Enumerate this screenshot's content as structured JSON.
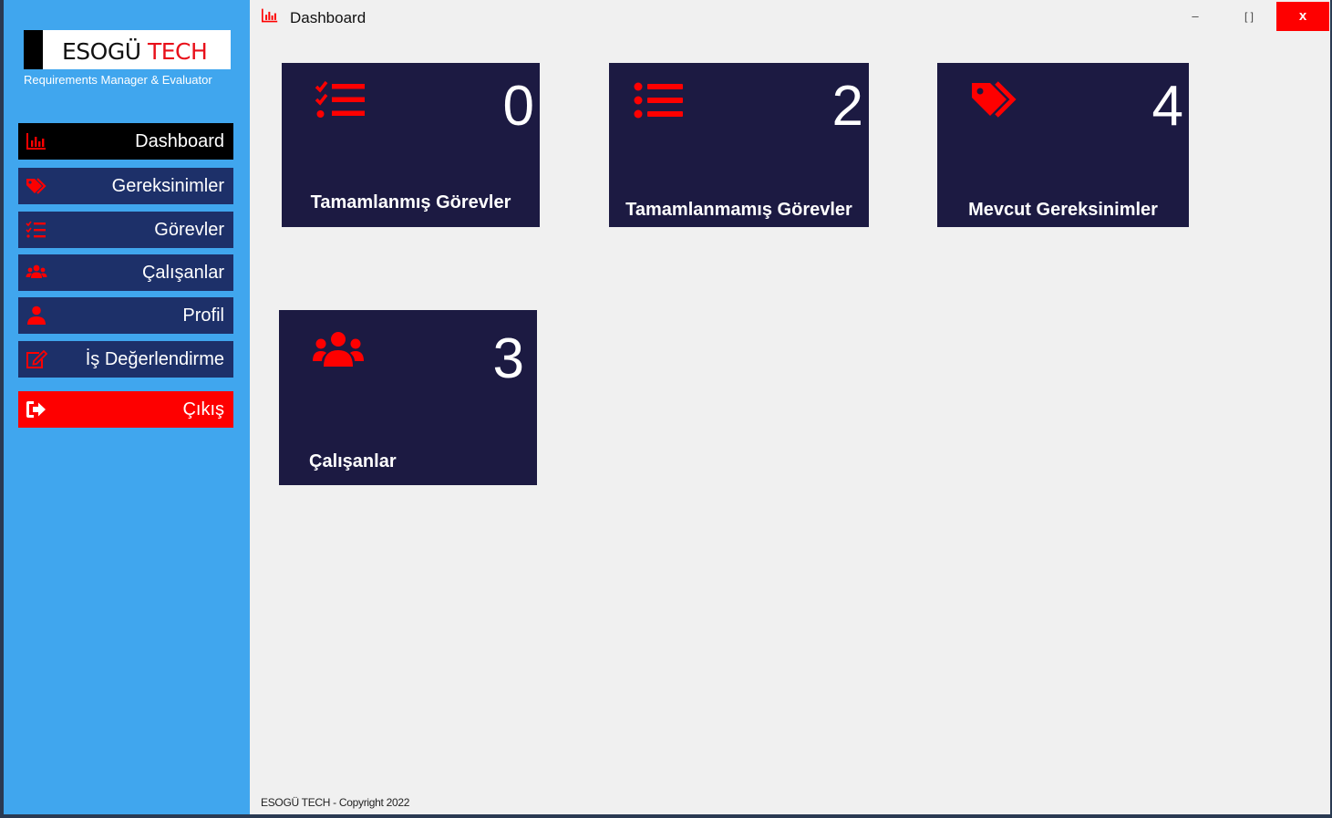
{
  "brand": {
    "name_part1": "ESOGÜ",
    "name_part2": "TECH",
    "subtitle": "Requirements Manager & Evaluator"
  },
  "window": {
    "title": "Dashboard",
    "minimize": "–",
    "maximize": "[ ]",
    "close": "x"
  },
  "sidebar": {
    "items": [
      {
        "label": "Dashboard",
        "icon": "chart-bar-icon",
        "active": true
      },
      {
        "label": "Gereksinimler",
        "icon": "tags-icon"
      },
      {
        "label": "Görevler",
        "icon": "tasks-list-icon"
      },
      {
        "label": "Çalışanlar",
        "icon": "users-icon"
      },
      {
        "label": "Profil",
        "icon": "user-icon"
      },
      {
        "label": "İş Değerlendirme",
        "icon": "edit-icon"
      }
    ],
    "logout": {
      "label": "Çıkış",
      "icon": "sign-out-icon"
    }
  },
  "cards": [
    {
      "label": "Tamamlanmış Görevler",
      "count": "0",
      "icon": "tasks-check-icon"
    },
    {
      "label": "Tamamlanmamış Görevler",
      "count": "2",
      "icon": "list-icon"
    },
    {
      "label": "Mevcut Gereksinimler",
      "count": "4",
      "icon": "tags-icon"
    },
    {
      "label": "Çalışanlar",
      "count": "3",
      "icon": "users-icon"
    }
  ],
  "footer": {
    "text": "ESOGÜ TECH - Copyright 2022"
  },
  "colors": {
    "sidebar_bg": "#40a6ee",
    "nav_item_bg": "#1d3069",
    "nav_active_bg": "#000000",
    "logout_bg": "#fe0000",
    "card_bg": "#1c1a42",
    "accent_red": "#fe0000"
  }
}
